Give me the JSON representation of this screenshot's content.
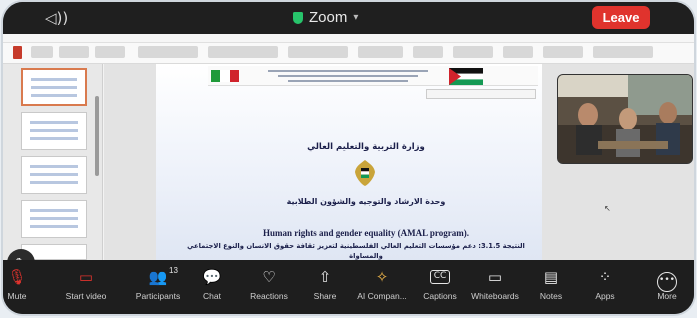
{
  "window": {
    "app_title": "Zoom",
    "leave_label": "Leave",
    "speaker_icon": "speaker-icon",
    "accent_leave": "#e0332d",
    "security_color": "#27c46b"
  },
  "slide": {
    "ministry": "وزارة التربية والتعليم العالي",
    "unit": "وحدة الارشاد والتوجيه والشؤون الطلابية",
    "english_title": "Human rights and gender equality (AMAL program).",
    "result_line1": "النتيجة 3.1.5: دعم مؤسسات التعليم العالي الفلسطينية لتعزيز ثقافة حقوق الانسان والنوع الاجتماعي",
    "result_line2": "والمساواة"
  },
  "toolbar": {
    "mute": "Mute",
    "start_video": "Start video",
    "participants": "Participants",
    "participants_count": "13",
    "chat": "Chat",
    "reactions": "Reactions",
    "share": "Share",
    "ai_companion": "AI Compan...",
    "captions": "Captions",
    "captions_icon_text": "CC",
    "whiteboards": "Whiteboards",
    "notes": "Notes",
    "apps": "Apps",
    "more": "More"
  }
}
